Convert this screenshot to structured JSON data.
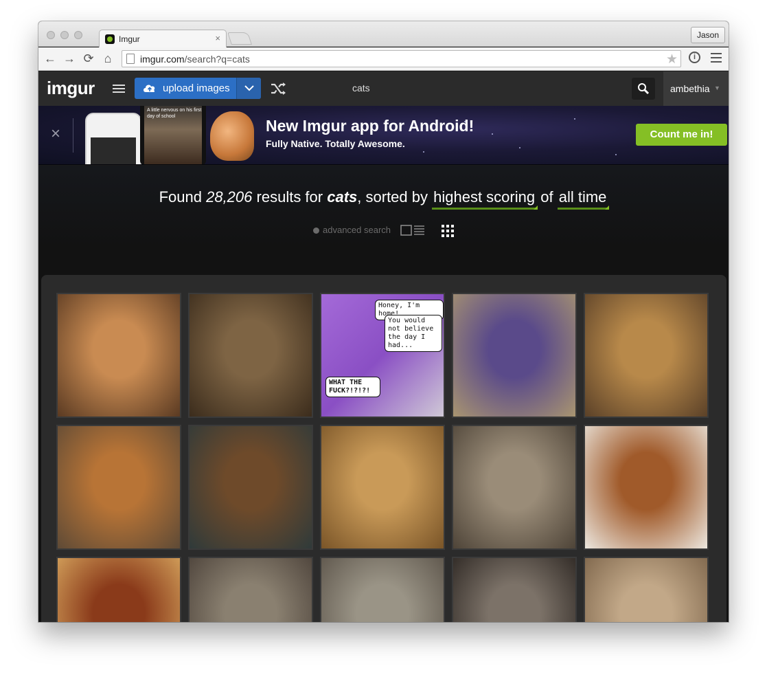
{
  "browser": {
    "tab_title": "Imgur",
    "tab_close": "×",
    "profile_name": "Jason",
    "url_host": "imgur.com",
    "url_path": "/search?q=cats",
    "nav": {
      "back": "←",
      "forward": "→",
      "reload": "⟳",
      "home": "⌂"
    },
    "star": "★",
    "ext_label": "i"
  },
  "header": {
    "logo": "imgur",
    "upload_label": "upload images",
    "search_value": "cats",
    "username": "ambethia",
    "user_caret": "▼"
  },
  "banner": {
    "close": "×",
    "phone_caption": "A little nervous on his first day of school",
    "title": "New Imgur app for Android!",
    "subtitle": "Fully Native. Totally Awesome.",
    "cta": "Count me in!",
    "accent": "#85bf25"
  },
  "results": {
    "prefix": "Found",
    "count": "28,206",
    "mid": "results for",
    "query": "cats",
    "sorted_by_label": ", sorted by",
    "sort": "highest scoring",
    "of": "of",
    "range": "all time",
    "advanced_search": "advanced search"
  },
  "comic": {
    "bubble1": "Honey, I'm home!",
    "bubble2": "You would not believe the day I had...",
    "bubble3": "WHAT THE FUCK?!?!?!"
  },
  "thumbnails": [
    {
      "label": "cat at dinner table",
      "c1": "#c98b52",
      "c2": "#5a3a22"
    },
    {
      "label": "cat with glass bowl",
      "c1": "#7e6444",
      "c2": "#3b2c1c"
    },
    {
      "label": "cartoon cats comic",
      "c1": "#9a5fd0",
      "c2": "#d9d9d9"
    },
    {
      "label": "cat in doll bed",
      "c1": "#5a4a8a",
      "c2": "#a99570"
    },
    {
      "label": "boy reading to cat",
      "c1": "#b8894a",
      "c2": "#5b4128"
    },
    {
      "label": "fox in leaves",
      "c1": "#b87436",
      "c2": "#5e4a36"
    },
    {
      "label": "cat in hallway",
      "c1": "#6e4a2a",
      "c2": "#2f3a3a"
    },
    {
      "label": "smiling golden retriever",
      "c1": "#c99a58",
      "c2": "#7a5528"
    },
    {
      "label": "cat by window",
      "c1": "#9a8c78",
      "c2": "#4e4438"
    },
    {
      "label": "man with tiny cat",
      "c1": "#a05a2a",
      "c2": "#ece7df"
    },
    {
      "label": "cats at window",
      "c1": "#8a3a1a",
      "c2": "#d8a860"
    },
    {
      "label": "grey cat close up",
      "c1": "#8a8070",
      "c2": "#4a4038"
    },
    {
      "label": "tabby cat sitting",
      "c1": "#9a9486",
      "c2": "#5a5248"
    },
    {
      "label": "husky on floor",
      "c1": "#7c7268",
      "c2": "#2a2420"
    },
    {
      "label": "lion cub",
      "c1": "#c2a888",
      "c2": "#7a6248"
    }
  ]
}
